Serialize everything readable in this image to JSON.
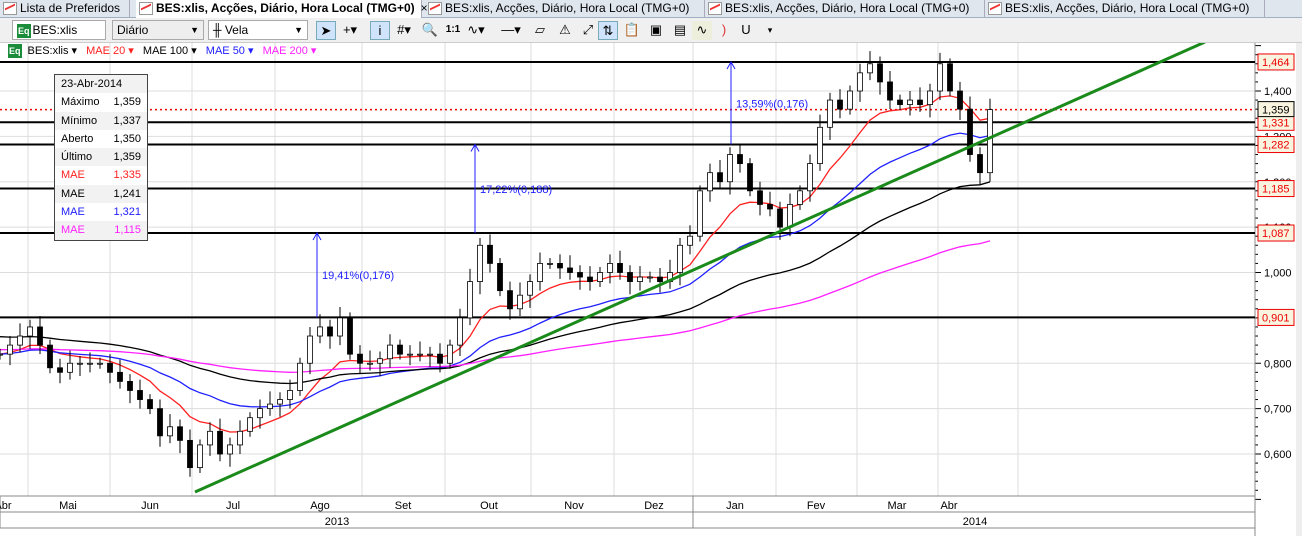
{
  "tabs": [
    {
      "label": "Lista de Preferidos"
    },
    {
      "label": "BES:xlis, Acções, Diário, Hora Local (TMG+0)",
      "close": "×"
    },
    {
      "label": "BES:xlis, Acções, Diário, Hora Local (TMG+0)"
    },
    {
      "label": "BES:xlis, Acções, Diário, Hora Local (TMG+0)"
    },
    {
      "label": "BES:xlis, Acções, Diário, Hora Local (TMG+0)"
    }
  ],
  "toolbar": {
    "symbol": "BES:xlis",
    "eq": "Eq",
    "period": "Diário",
    "chart_type": "Vela",
    "ratio": "1:1"
  },
  "legend": {
    "symbol": "BES:xlis ▾",
    "ma20": "MAE 20 ▾",
    "ma100": "MAE 100 ▾",
    "ma50": "MAE 50 ▾",
    "ma200": "MAE 200 ▾"
  },
  "info": {
    "date": "23-Abr-2014",
    "rows": [
      {
        "k": "Máximo",
        "v": "1,359",
        "c": "#000"
      },
      {
        "k": "Mínimo",
        "v": "1,337",
        "c": "#000"
      },
      {
        "k": "Aberto",
        "v": "1,350",
        "c": "#000"
      },
      {
        "k": "Último",
        "v": "1,359",
        "c": "#000"
      },
      {
        "k": "MAE",
        "v": "1,335",
        "c": "#ff2020"
      },
      {
        "k": "MAE",
        "v": "1,241",
        "c": "#000"
      },
      {
        "k": "MAE",
        "v": "1,321",
        "c": "#2020ff"
      },
      {
        "k": "MAE",
        "v": "1,115",
        "c": "#ff20ff"
      }
    ]
  },
  "chart_data": {
    "type": "candlestick",
    "ylim": [
      0.5,
      1.56
    ],
    "yticks": [
      "1,400",
      "1,300",
      "1,200",
      "1,100",
      "1,000",
      "0,900",
      "0,800",
      "0,700",
      "0,600"
    ],
    "ytick_values": [
      1.4,
      1.3,
      1.2,
      1.1,
      1.0,
      0.9,
      0.8,
      0.7,
      0.6
    ],
    "months": [
      "Abr",
      "Mai",
      "Jun",
      "Jul",
      "Ago",
      "Set",
      "Out",
      "Nov",
      "Dez",
      "Jan",
      "Fev",
      "Mar",
      "Abr"
    ],
    "years": [
      "2013",
      "2014"
    ],
    "closes": [
      0.82,
      0.84,
      0.86,
      0.88,
      0.84,
      0.79,
      0.78,
      0.8,
      0.8,
      0.8,
      0.8,
      0.78,
      0.76,
      0.74,
      0.72,
      0.7,
      0.64,
      0.66,
      0.63,
      0.57,
      0.62,
      0.65,
      0.6,
      0.62,
      0.65,
      0.68,
      0.7,
      0.71,
      0.72,
      0.74,
      0.8,
      0.86,
      0.88,
      0.86,
      0.9,
      0.82,
      0.8,
      0.8,
      0.81,
      0.84,
      0.82,
      0.82,
      0.82,
      0.82,
      0.8,
      0.84,
      0.9,
      0.98,
      1.06,
      1.02,
      0.96,
      0.92,
      0.95,
      0.98,
      1.02,
      1.02,
      1.01,
      1.0,
      0.99,
      0.98,
      1.0,
      1.02,
      1.0,
      0.98,
      0.99,
      0.99,
      0.98,
      1.0,
      1.06,
      1.08,
      1.18,
      1.22,
      1.2,
      1.26,
      1.24,
      1.18,
      1.15,
      1.14,
      1.1,
      1.15,
      1.18,
      1.24,
      1.32,
      1.38,
      1.36,
      1.4,
      1.44,
      1.46,
      1.42,
      1.38,
      1.37,
      1.38,
      1.37,
      1.4,
      1.46,
      1.4,
      1.36,
      1.26,
      1.22,
      1.359
    ],
    "moving_averages": [
      {
        "name": "MAE 20",
        "color": "#ff2020",
        "last": 1.335
      },
      {
        "name": "MAE 50",
        "color": "#2020ff",
        "last": 1.321
      },
      {
        "name": "MAE 100",
        "color": "#000000",
        "last": 1.241
      },
      {
        "name": "MAE 200",
        "color": "#ff20ff",
        "last": 1.115
      }
    ],
    "levels": [
      1.464,
      1.331,
      1.282,
      1.185,
      1.087,
      0.901
    ],
    "level_labels": [
      "1,464",
      "1,331",
      "1,282",
      "1,185",
      "1,087",
      "0,901"
    ],
    "last_price": 1.359,
    "last_label": "1,359",
    "measures": [
      {
        "from": 0.901,
        "to": 1.087,
        "label": "19,41%(0,176)"
      },
      {
        "from": 1.087,
        "to": 1.282,
        "label": "17,22%(0,188)"
      },
      {
        "from": 1.282,
        "to": 1.464,
        "label": "13,59%(0,176)"
      }
    ],
    "trendline_color": "#1a8a1a"
  }
}
